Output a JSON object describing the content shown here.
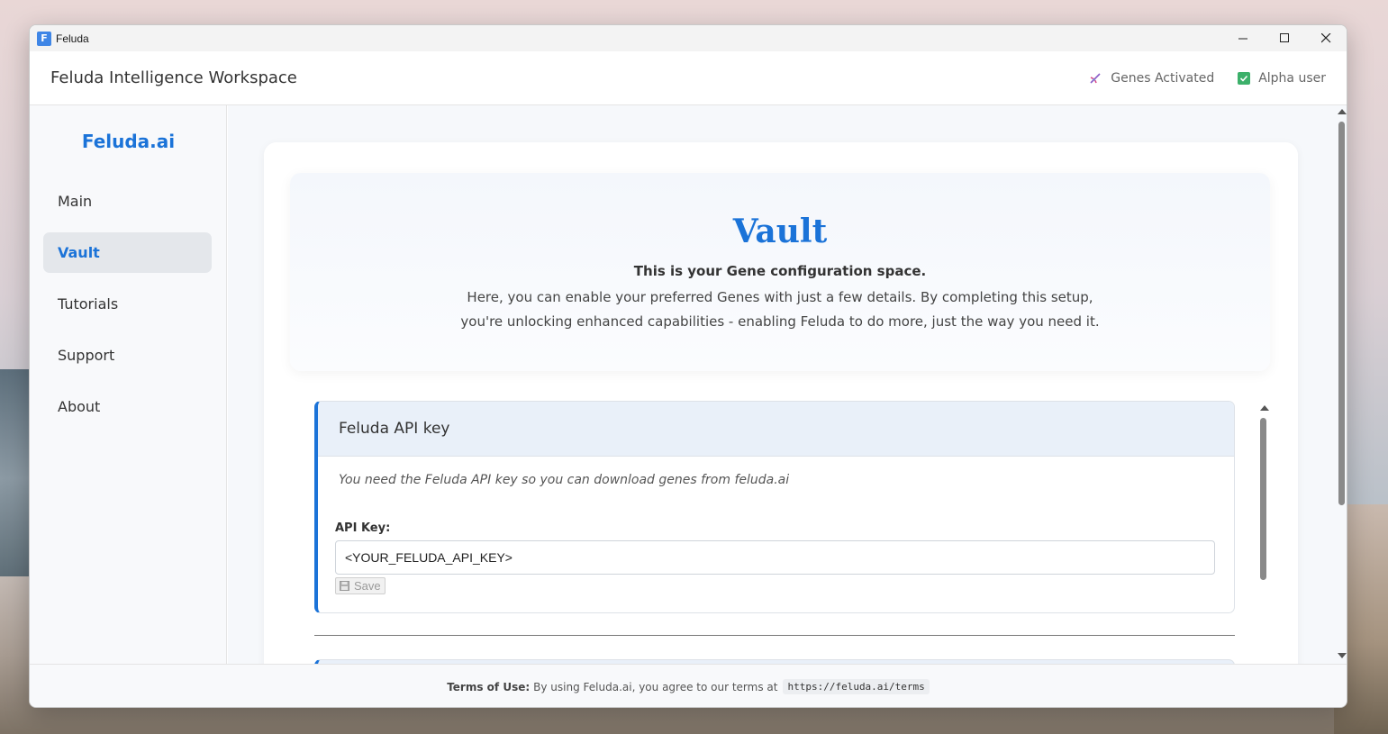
{
  "window": {
    "title": "Feluda",
    "app_icon_letter": "F"
  },
  "header": {
    "title": "Feluda Intelligence Workspace",
    "genes_status": "Genes Activated",
    "user_status": "Alpha user"
  },
  "sidebar": {
    "brand": "Feluda.ai",
    "items": [
      {
        "label": "Main"
      },
      {
        "label": "Vault",
        "active": true
      },
      {
        "label": "Tutorials"
      },
      {
        "label": "Support"
      },
      {
        "label": "About"
      }
    ]
  },
  "vault": {
    "title": "Vault",
    "subtitle": "This is your Gene configuration space.",
    "description": "Here, you can enable your preferred Genes with just a few details. By completing this setup, you're unlocking enhanced capabilities - enabling Feluda to do more, just the way you need it."
  },
  "api_card": {
    "title": "Feluda API key",
    "note": "You need the Feluda API key so you can download genes from feluda.ai",
    "field_label": "API Key:",
    "field_value": "<YOUR_FELUDA_API_KEY>",
    "save_label": "Save"
  },
  "footer": {
    "label": "Terms of Use:",
    "text": "By using Feluda.ai, you agree to our terms at",
    "url": "https://feluda.ai/terms"
  },
  "colors": {
    "accent": "#1b73d8",
    "success": "#3cb06a"
  }
}
